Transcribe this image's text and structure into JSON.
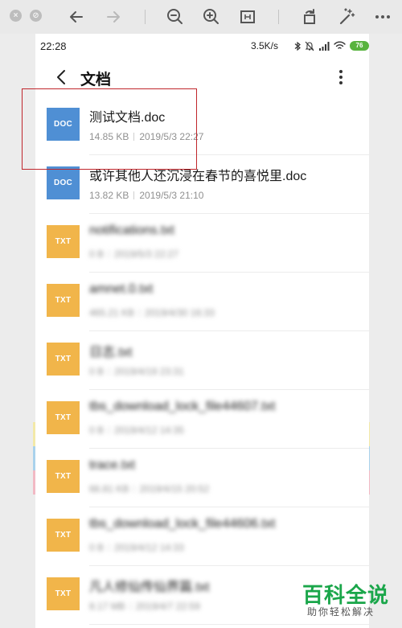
{
  "status_bar": {
    "time": "22:28",
    "speed": "3.5K/s",
    "battery": "76"
  },
  "header": {
    "title": "文档"
  },
  "files": [
    {
      "name": "测试文档.doc",
      "size": "14.85 KB",
      "date": "2019/5/3 22:27",
      "type": "DOC"
    },
    {
      "name": "或许其他人还沉浸在春节的喜悦里.doc",
      "size": "13.82 KB",
      "date": "2019/5/3 21:10",
      "type": "DOC"
    },
    {
      "name": "notifications.txt",
      "size": "0 B",
      "date": "2019/5/3 22:27",
      "type": "TXT"
    },
    {
      "name": "amnet.0.txt",
      "size": "465.21 KB",
      "date": "2019/4/30 16:33",
      "type": "TXT"
    },
    {
      "name": "日志.txt",
      "size": "0 B",
      "date": "2019/4/19 23:31",
      "type": "TXT"
    },
    {
      "name": "tbs_download_lock_file44607.txt",
      "size": "0 B",
      "date": "2019/4/12 14:35",
      "type": "TXT"
    },
    {
      "name": "trace.txt",
      "size": "66.81 KB",
      "date": "2019/4/15 20:52",
      "type": "TXT"
    },
    {
      "name": "tbs_download_lock_file44606.txt",
      "size": "0 B",
      "date": "2019/4/12 14:33",
      "type": "TXT"
    },
    {
      "name": "凡人修仙传仙界篇.txt",
      "size": "8.17 MB",
      "date": "2019/4/7 22:59",
      "type": "TXT"
    }
  ],
  "watermark": {
    "main": "百科全说",
    "sub": "助你轻松解决"
  },
  "colors": {
    "doc_badge": "#4f8fd4",
    "txt_badge": "#f1b54a",
    "highlight": "#c0262c",
    "watermark": "#1aa64a"
  },
  "icons": [
    "close-icon",
    "minimize-icon",
    "back-arrow-icon",
    "forward-arrow-icon",
    "zoom-out-icon",
    "zoom-in-icon",
    "fit-icon",
    "rotate-icon",
    "magic-wand-icon",
    "more-icon"
  ]
}
